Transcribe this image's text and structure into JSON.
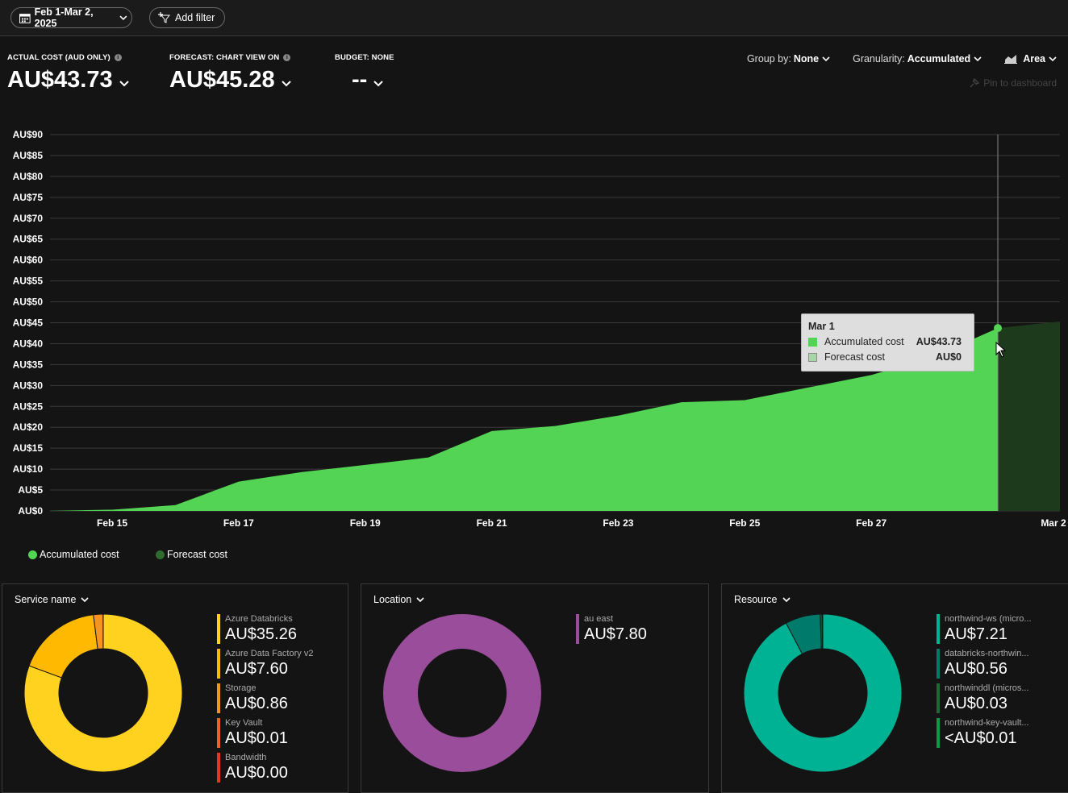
{
  "toolbar": {
    "date_range": "Feb 1-Mar 2, 2025",
    "add_filter": "Add filter"
  },
  "kpis": {
    "actual": {
      "label": "ACTUAL COST (AUD ONLY)",
      "value": "AU$43.73"
    },
    "forecast": {
      "label": "FORECAST: CHART VIEW ON",
      "value": "AU$45.28"
    },
    "budget": {
      "label": "BUDGET: NONE",
      "value": "--"
    }
  },
  "controls": {
    "group_by": {
      "label": "Group by:",
      "value": "None"
    },
    "granularity": {
      "label": "Granularity:",
      "value": "Accumulated"
    },
    "view": {
      "value": "Area"
    },
    "pin": "Pin to dashboard"
  },
  "colors": {
    "accumulated": "#54d454",
    "forecast": "#1d3a1d",
    "forecast_legend": "#2e6b2e",
    "grid": "#3a3a3a"
  },
  "chart_data": {
    "type": "area",
    "y_ticks": [
      "AU$0",
      "AU$5",
      "AU$10",
      "AU$15",
      "AU$20",
      "AU$25",
      "AU$30",
      "AU$35",
      "AU$40",
      "AU$45",
      "AU$50",
      "AU$55",
      "AU$60",
      "AU$65",
      "AU$70",
      "AU$75",
      "AU$80",
      "AU$85",
      "AU$90"
    ],
    "x_ticks": [
      {
        "label": "Feb 15",
        "day": 15
      },
      {
        "label": "Feb 17",
        "day": 17
      },
      {
        "label": "Feb 19",
        "day": 19
      },
      {
        "label": "Feb 21",
        "day": 21
      },
      {
        "label": "Feb 23",
        "day": 23
      },
      {
        "label": "Feb 25",
        "day": 25
      },
      {
        "label": "Feb 27",
        "day": 27
      },
      {
        "label": "Mar 2",
        "day": 30
      }
    ],
    "ylim": [
      0,
      90
    ],
    "series": [
      {
        "name": "Accumulated cost",
        "days": [
          14,
          15,
          16,
          17,
          18,
          19,
          20,
          21,
          22,
          23,
          24,
          25,
          26,
          27,
          28,
          29
        ],
        "values": [
          0,
          0.3,
          1.4,
          7,
          9.3,
          11,
          12.8,
          19.1,
          20.3,
          22.8,
          26,
          26.5,
          29.5,
          32.5,
          37,
          43.73
        ]
      },
      {
        "name": "Forecast cost",
        "days": [
          29,
          30
        ],
        "values": [
          43.73,
          45.28
        ]
      }
    ]
  },
  "tooltip": {
    "title": "Mar 1",
    "rows": [
      {
        "label": "Accumulated cost",
        "value": "AU$43.73"
      },
      {
        "label": "Forecast cost",
        "value": "AU$0"
      }
    ]
  },
  "legend": [
    "Accumulated cost",
    "Forecast cost"
  ],
  "panels": [
    {
      "title": "Service name",
      "items": [
        {
          "name": "Azure Databricks",
          "amount": "AU$35.26",
          "value": 35.26,
          "color": "#ffd21f"
        },
        {
          "name": "Azure Data Factory v2",
          "amount": "AU$7.60",
          "value": 7.6,
          "color": "#ffb900"
        },
        {
          "name": "Storage",
          "amount": "AU$0.86",
          "value": 0.86,
          "color": "#f7941d"
        },
        {
          "name": "Key Vault",
          "amount": "AU$0.01",
          "value": 0.01,
          "color": "#e8661e"
        },
        {
          "name": "Bandwidth",
          "amount": "AU$0.00",
          "value": 0.0,
          "color": "#e03a1c"
        }
      ]
    },
    {
      "title": "Location",
      "items": [
        {
          "name": "au east",
          "amount": "AU$7.80",
          "value": 7.8,
          "color": "#9a4d9a"
        }
      ]
    },
    {
      "title": "Resource",
      "items": [
        {
          "name": "northwind-ws (micro...",
          "amount": "AU$7.21",
          "value": 7.21,
          "color": "#00b294"
        },
        {
          "name": "databricks-northwin...",
          "amount": "AU$0.56",
          "value": 0.56,
          "color": "#007a6a"
        },
        {
          "name": "northwinddl (micros...",
          "amount": "AU$0.03",
          "value": 0.03,
          "color": "#1d6b34"
        },
        {
          "name": "northwind-key-vault...",
          "amount": "<AU$0.01",
          "value": 0.01,
          "color": "#0c9a48"
        }
      ]
    }
  ]
}
